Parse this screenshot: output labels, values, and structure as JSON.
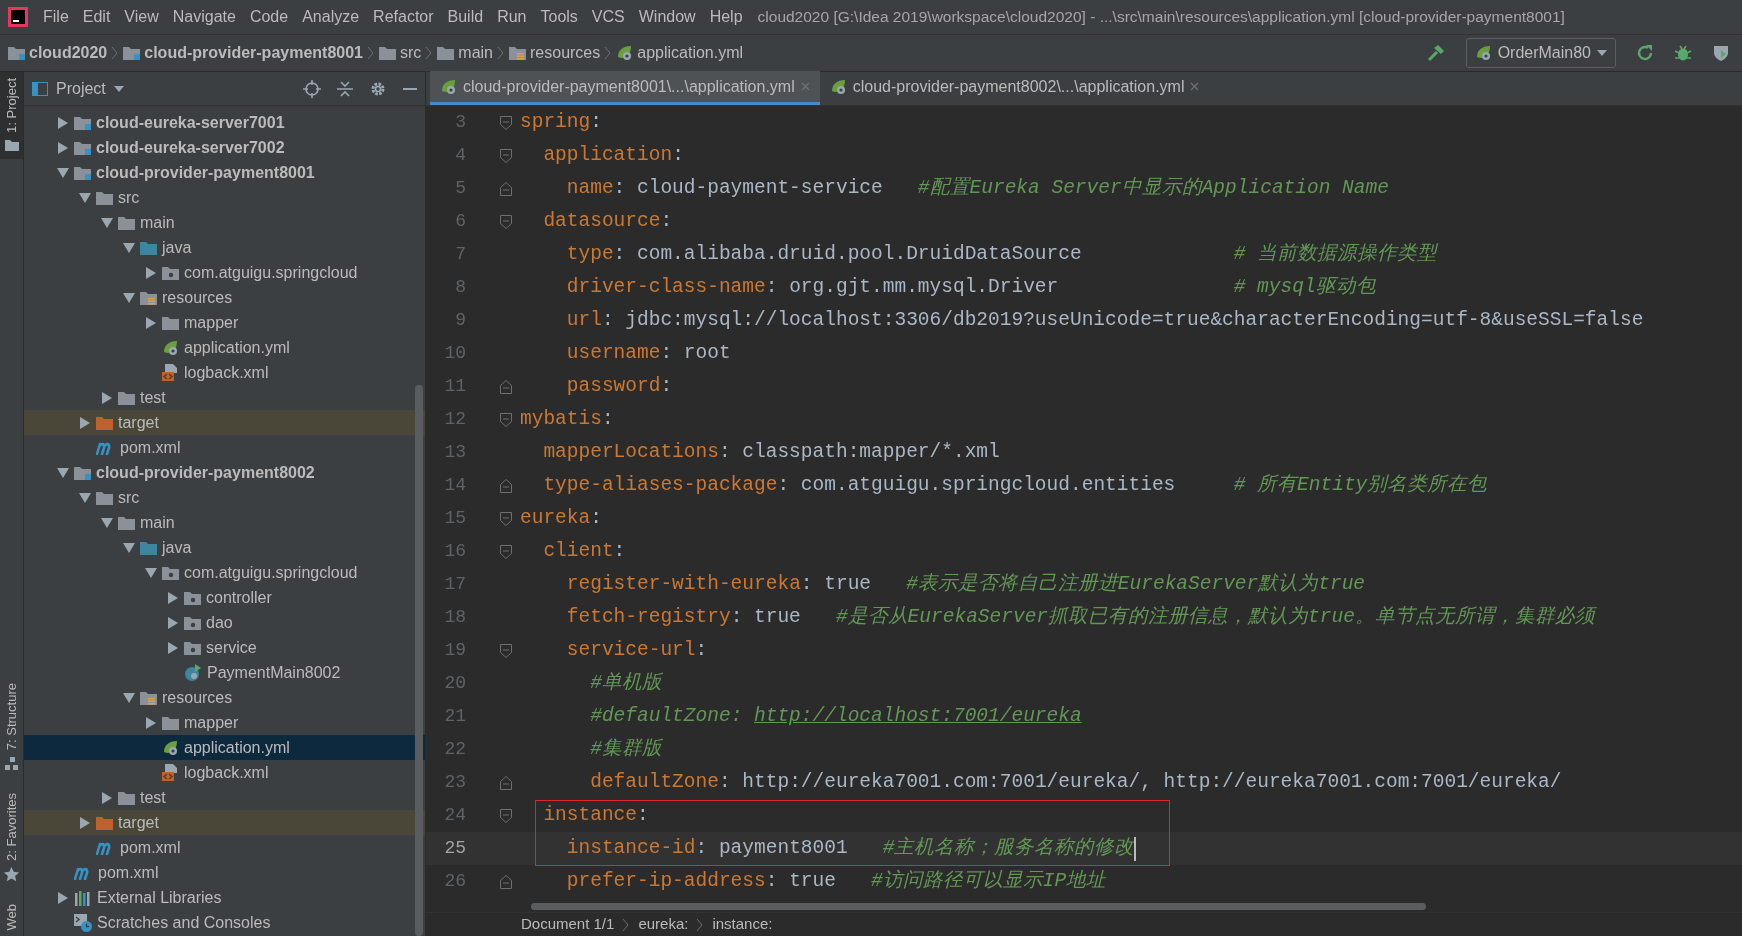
{
  "menu": {
    "items": [
      "File",
      "Edit",
      "View",
      "Navigate",
      "Code",
      "Analyze",
      "Refactor",
      "Build",
      "Run",
      "Tools",
      "VCS",
      "Window",
      "Help"
    ],
    "title": "cloud2020 [G:\\Idea 2019\\workspace\\cloud2020] - ...\\src\\main\\resources\\application.yml [cloud-provider-payment8001]"
  },
  "navbar": {
    "crumbs": [
      {
        "label": "cloud2020",
        "kind": "module"
      },
      {
        "label": "cloud-provider-payment8001",
        "kind": "module"
      },
      {
        "label": "src",
        "kind": "folder"
      },
      {
        "label": "main",
        "kind": "folder"
      },
      {
        "label": "resources",
        "kind": "resources"
      },
      {
        "label": "application.yml",
        "kind": "yml"
      }
    ],
    "run_config": "OrderMain80"
  },
  "tool_windows": [
    {
      "label": "1: Project",
      "selected": true,
      "kind": "project"
    },
    {
      "label": "7: Structure",
      "selected": false,
      "kind": "structure"
    },
    {
      "label": "2: Favorites",
      "selected": false,
      "kind": "favorites"
    },
    {
      "label": "Web",
      "selected": false,
      "kind": "web"
    }
  ],
  "project": {
    "title": "Project",
    "tree": [
      {
        "label": "cloud-eureka-server7001",
        "kind": "module",
        "expanded": false,
        "selected": false
      },
      {
        "label": "cloud-eureka-server7002",
        "kind": "module",
        "expanded": false,
        "selected": false
      },
      {
        "label": "cloud-provider-payment8001",
        "kind": "module",
        "expanded": true,
        "selected": false,
        "children": [
          {
            "label": "src",
            "kind": "folder",
            "expanded": true,
            "selected": false,
            "children": [
              {
                "label": "main",
                "kind": "folder",
                "expanded": true,
                "selected": false,
                "children": [
                  {
                    "label": "java",
                    "kind": "source",
                    "expanded": true,
                    "selected": false,
                    "children": [
                      {
                        "label": "com.atguigu.springcloud",
                        "kind": "package",
                        "expanded": false,
                        "selected": false
                      }
                    ]
                  },
                  {
                    "label": "resources",
                    "kind": "resources",
                    "expanded": true,
                    "selected": false,
                    "children": [
                      {
                        "label": "mapper",
                        "kind": "folder",
                        "expanded": false,
                        "selected": false
                      },
                      {
                        "label": "application.yml",
                        "kind": "yml",
                        "selected": false
                      },
                      {
                        "label": "logback.xml",
                        "kind": "xml",
                        "selected": false
                      }
                    ]
                  }
                ]
              },
              {
                "label": "test",
                "kind": "folder",
                "expanded": false,
                "selected": false
              }
            ]
          },
          {
            "label": "target",
            "kind": "excluded",
            "expanded": false,
            "selected": false
          },
          {
            "label": "pom.xml",
            "kind": "maven",
            "selected": false
          }
        ]
      },
      {
        "label": "cloud-provider-payment8002",
        "kind": "module",
        "expanded": true,
        "selected": false,
        "children": [
          {
            "label": "src",
            "kind": "folder",
            "expanded": true,
            "selected": false,
            "children": [
              {
                "label": "main",
                "kind": "folder",
                "expanded": true,
                "selected": false,
                "children": [
                  {
                    "label": "java",
                    "kind": "source",
                    "expanded": true,
                    "selected": false,
                    "children": [
                      {
                        "label": "com.atguigu.springcloud",
                        "kind": "package",
                        "expanded": true,
                        "selected": false,
                        "children": [
                          {
                            "label": "controller",
                            "kind": "package",
                            "expanded": false,
                            "selected": false
                          },
                          {
                            "label": "dao",
                            "kind": "package",
                            "expanded": false,
                            "selected": false
                          },
                          {
                            "label": "service",
                            "kind": "package",
                            "expanded": false,
                            "selected": false
                          },
                          {
                            "label": "PaymentMain8002",
                            "kind": "class",
                            "selected": false
                          }
                        ]
                      }
                    ]
                  },
                  {
                    "label": "resources",
                    "kind": "resources",
                    "expanded": true,
                    "selected": false,
                    "children": [
                      {
                        "label": "mapper",
                        "kind": "folder",
                        "expanded": false,
                        "selected": false
                      },
                      {
                        "label": "application.yml",
                        "kind": "yml",
                        "selected": true
                      },
                      {
                        "label": "logback.xml",
                        "kind": "xml",
                        "selected": false
                      }
                    ]
                  }
                ]
              },
              {
                "label": "test",
                "kind": "folder",
                "expanded": false,
                "selected": false
              }
            ]
          },
          {
            "label": "target",
            "kind": "excluded",
            "expanded": false,
            "selected": false
          },
          {
            "label": "pom.xml",
            "kind": "maven",
            "selected": false
          }
        ]
      },
      {
        "label": "pom.xml",
        "kind": "maven",
        "selected": false
      },
      {
        "label": "External Libraries",
        "kind": "libraries",
        "expanded": false,
        "selected": false
      },
      {
        "label": "Scratches and Consoles",
        "kind": "scratches",
        "selected": false
      }
    ]
  },
  "tabs": [
    {
      "label": "cloud-provider-payment8001\\...\\application.yml",
      "selected": true
    },
    {
      "label": "cloud-provider-payment8002\\...\\application.yml",
      "selected": false
    }
  ],
  "editor": {
    "lines": [
      {
        "number": "3",
        "kind": "fold-start",
        "current": false,
        "boxed": false,
        "tokens": [
          {
            "text": "spring",
            "kind": "key"
          },
          {
            "text": ":",
            "kind": "colon"
          }
        ],
        "children": [
          {
            "number": "4",
            "kind": "fold-start",
            "current": false,
            "boxed": false,
            "tokens": [
              {
                "text": "application",
                "kind": "key"
              },
              {
                "text": ":",
                "kind": "colon"
              }
            ],
            "children": [
              {
                "number": "5",
                "kind": "fold-end",
                "current": false,
                "boxed": false,
                "tokens": [
                  {
                    "text": "name",
                    "kind": "key"
                  },
                  {
                    "text": ":",
                    "kind": "colon"
                  },
                  {
                    "text": "cloud-payment-service",
                    "kind": "value"
                  },
                  {
                    "text": "#配置Eureka Server中显示的Application Name",
                    "kind": "comment"
                  }
                ]
              }
            ]
          },
          {
            "number": "6",
            "kind": "fold-start",
            "current": false,
            "boxed": false,
            "tokens": [
              {
                "text": "datasource",
                "kind": "key"
              },
              {
                "text": ":",
                "kind": "colon"
              }
            ],
            "children": [
              {
                "number": "7",
                "kind": "plain",
                "current": false,
                "boxed": false,
                "tokens": [
                  {
                    "text": "type",
                    "kind": "key"
                  },
                  {
                    "text": ":",
                    "kind": "colon"
                  },
                  {
                    "text": "com.alibaba.druid.pool.DruidDataSource",
                    "kind": "value"
                  },
                  {
                    "text": "# 当前数据源操作类型",
                    "kind": "column-comment"
                  }
                ]
              },
              {
                "number": "8",
                "kind": "plain",
                "current": false,
                "boxed": false,
                "tokens": [
                  {
                    "text": "driver-class-name",
                    "kind": "key"
                  },
                  {
                    "text": ":",
                    "kind": "colon"
                  },
                  {
                    "text": "org.gjt.mm.mysql.Driver",
                    "kind": "value"
                  },
                  {
                    "text": "# mysql驱动包",
                    "kind": "column-comment"
                  }
                ]
              },
              {
                "number": "9",
                "kind": "plain",
                "current": false,
                "boxed": false,
                "tokens": [
                  {
                    "text": "url",
                    "kind": "key"
                  },
                  {
                    "text": ":",
                    "kind": "colon"
                  },
                  {
                    "text": "jdbc:mysql://localhost:3306/db2019?useUnicode=true&characterEncoding=utf-8&useSSL=false",
                    "kind": "value"
                  }
                ]
              },
              {
                "number": "10",
                "kind": "plain",
                "current": false,
                "boxed": false,
                "tokens": [
                  {
                    "text": "username",
                    "kind": "key"
                  },
                  {
                    "text": ":",
                    "kind": "colon"
                  },
                  {
                    "text": "root",
                    "kind": "value"
                  }
                ]
              },
              {
                "number": "11",
                "kind": "fold-end",
                "current": false,
                "boxed": false,
                "tokens": [
                  {
                    "text": "password",
                    "kind": "key"
                  },
                  {
                    "text": ":",
                    "kind": "colon"
                  }
                ]
              }
            ]
          }
        ]
      },
      {
        "number": "12",
        "kind": "fold-start",
        "current": false,
        "boxed": false,
        "tokens": [
          {
            "text": "mybatis",
            "kind": "key"
          },
          {
            "text": ":",
            "kind": "colon"
          }
        ],
        "children": [
          {
            "number": "13",
            "kind": "plain",
            "current": false,
            "boxed": false,
            "tokens": [
              {
                "text": "mapperLocations",
                "kind": "key"
              },
              {
                "text": ":",
                "kind": "colon"
              },
              {
                "text": "classpath:mapper/*.xml",
                "kind": "value"
              }
            ]
          },
          {
            "number": "14",
            "kind": "fold-end",
            "current": false,
            "boxed": false,
            "tokens": [
              {
                "text": "type-aliases-package",
                "kind": "key"
              },
              {
                "text": ":",
                "kind": "colon"
              },
              {
                "text": "com.atguigu.springcloud.entities",
                "kind": "value"
              },
              {
                "text": "# 所有Entity别名类所在包",
                "kind": "column-comment"
              }
            ]
          }
        ]
      },
      {
        "number": "15",
        "kind": "fold-start",
        "current": false,
        "boxed": false,
        "tokens": [
          {
            "text": "eureka",
            "kind": "key"
          },
          {
            "text": ":",
            "kind": "colon"
          }
        ],
        "children": [
          {
            "number": "16",
            "kind": "fold-start",
            "current": false,
            "boxed": false,
            "tokens": [
              {
                "text": "client",
                "kind": "key"
              },
              {
                "text": ":",
                "kind": "colon"
              }
            ],
            "children": [
              {
                "number": "17",
                "kind": "plain",
                "current": false,
                "boxed": false,
                "tokens": [
                  {
                    "text": "register-with-eureka",
                    "kind": "key"
                  },
                  {
                    "text": ":",
                    "kind": "colon"
                  },
                  {
                    "text": "true",
                    "kind": "value"
                  },
                  {
                    "text": "#表示是否将自己注册进EurekaServer默认为true",
                    "kind": "comment"
                  }
                ]
              },
              {
                "number": "18",
                "kind": "plain",
                "current": false,
                "boxed": false,
                "tokens": [
                  {
                    "text": "fetch-registry",
                    "kind": "key"
                  },
                  {
                    "text": ":",
                    "kind": "colon"
                  },
                  {
                    "text": "true",
                    "kind": "value"
                  },
                  {
                    "text": "#是否从EurekaServer抓取已有的注册信息，默认为true。单节点无所谓，集群必须",
                    "kind": "comment"
                  }
                ]
              },
              {
                "number": "19",
                "kind": "fold-start",
                "current": false,
                "boxed": false,
                "tokens": [
                  {
                    "text": "service-url",
                    "kind": "key"
                  },
                  {
                    "text": ":",
                    "kind": "colon"
                  }
                ],
                "children": [
                  {
                    "number": "20",
                    "kind": "plain",
                    "current": false,
                    "boxed": false,
                    "tokens": [
                      {
                        "text": "#单机版",
                        "kind": "line-comment"
                      }
                    ]
                  },
                  {
                    "number": "21",
                    "kind": "plain",
                    "current": false,
                    "boxed": false,
                    "tokens": [
                      {
                        "text": "#defaultZone:",
                        "kind": "line-comment"
                      },
                      {
                        "text": "http://localhost:7001/eureka",
                        "kind": "link"
                      }
                    ]
                  },
                  {
                    "number": "22",
                    "kind": "plain",
                    "current": false,
                    "boxed": false,
                    "tokens": [
                      {
                        "text": "#集群版",
                        "kind": "line-comment"
                      }
                    ]
                  },
                  {
                    "number": "23",
                    "kind": "fold-end",
                    "current": false,
                    "boxed": false,
                    "tokens": [
                      {
                        "text": "defaultZone",
                        "kind": "key"
                      },
                      {
                        "text": ":",
                        "kind": "colon"
                      },
                      {
                        "text": "http://eureka7001.com:7001/eureka/, http://eureka7001.com:7001/eureka/",
                        "kind": "value"
                      }
                    ]
                  }
                ]
              }
            ]
          },
          {
            "number": "24",
            "kind": "fold-start",
            "current": false,
            "boxed": true,
            "tokens": [
              {
                "text": "instance",
                "kind": "key"
              },
              {
                "text": ":",
                "kind": "colon"
              }
            ],
            "children": [
              {
                "number": "25",
                "kind": "plain",
                "current": true,
                "boxed": true,
                "tokens": [
                  {
                    "text": "instance-id",
                    "kind": "key"
                  },
                  {
                    "text": ":",
                    "kind": "colon"
                  },
                  {
                    "text": "payment8001",
                    "kind": "value"
                  },
                  {
                    "text": "#主机名称；服务名称的修改",
                    "kind": "comment"
                  }
                ]
              },
              {
                "number": "26",
                "kind": "fold-end",
                "current": false,
                "boxed": false,
                "tokens": [
                  {
                    "text": "prefer-ip-address",
                    "kind": "key"
                  },
                  {
                    "text": ":",
                    "kind": "colon"
                  },
                  {
                    "text": "true",
                    "kind": "value"
                  },
                  {
                    "text": "#访问路径可以显示IP地址",
                    "kind": "comment"
                  }
                ]
              }
            ]
          }
        ]
      }
    ]
  },
  "breadcrumbs": [
    "Document 1/1",
    "eureka:",
    "instance:"
  ]
}
